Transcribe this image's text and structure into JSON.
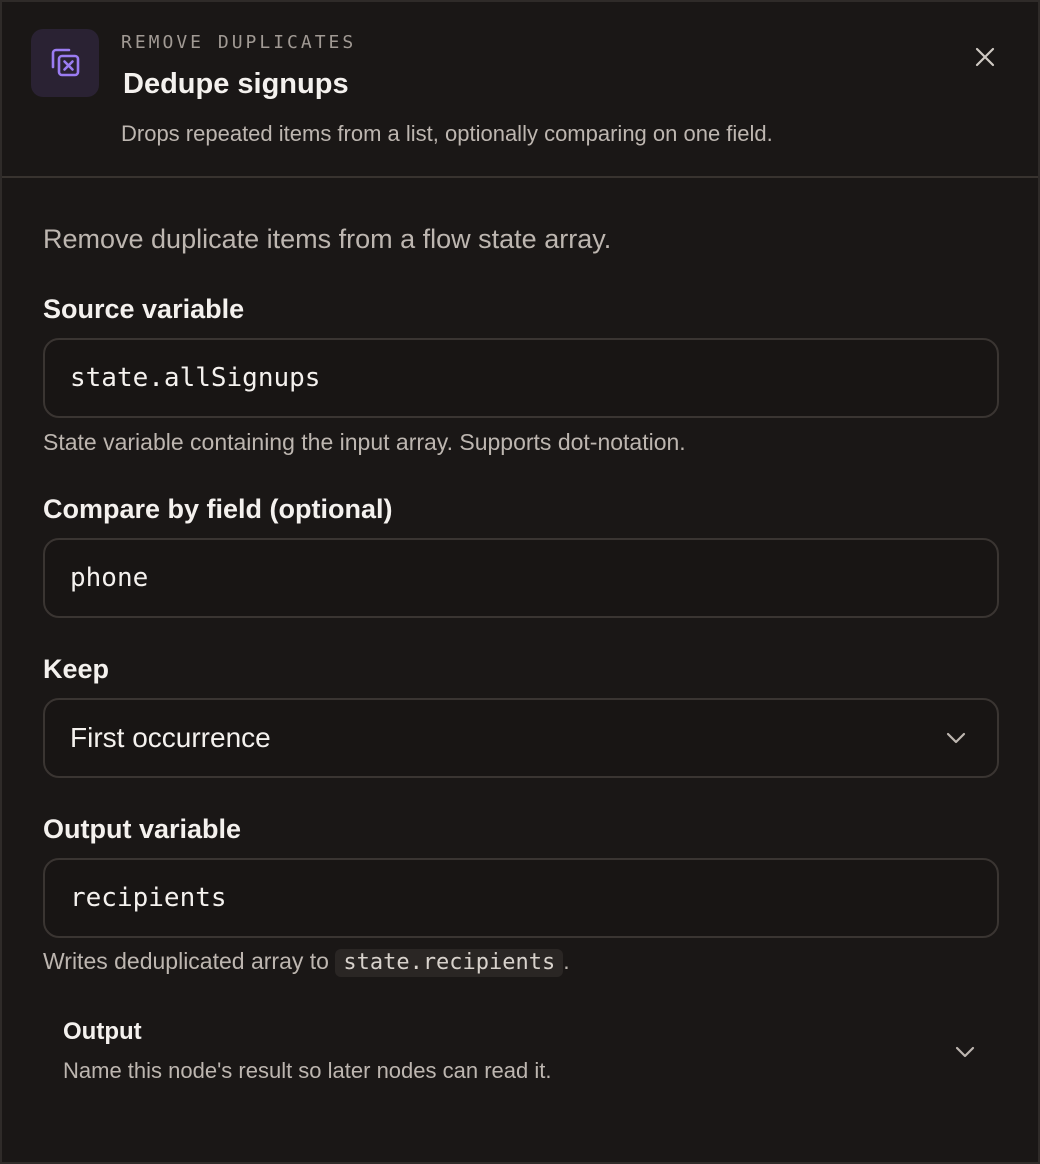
{
  "header": {
    "eyebrow": "REMOVE DUPLICATES",
    "title": "Dedupe signups",
    "subtitle": "Drops repeated items from a list, optionally comparing on one field.",
    "icon": "dedupe-icon",
    "close_icon": "close-icon"
  },
  "body": {
    "lead": "Remove duplicate items from a flow state array.",
    "source": {
      "label": "Source variable",
      "value": "state.allSignups",
      "help": "State variable containing the input array. Supports dot-notation."
    },
    "compare": {
      "label": "Compare by field (optional)",
      "value": "phone"
    },
    "keep": {
      "label": "Keep",
      "value": "First occurrence",
      "icon": "chevron-down-icon"
    },
    "output_var": {
      "label": "Output variable",
      "value": "recipients",
      "help_prefix": "Writes deduplicated array to",
      "help_code": "state.recipients",
      "help_suffix": "."
    },
    "output_section": {
      "title": "Output",
      "description": "Name this node's result so later nodes can read it.",
      "icon": "chevron-down-icon"
    }
  },
  "colors": {
    "background": "#1a1716",
    "accent": "#9b7cf2",
    "icon_tile": "#2a2233"
  }
}
